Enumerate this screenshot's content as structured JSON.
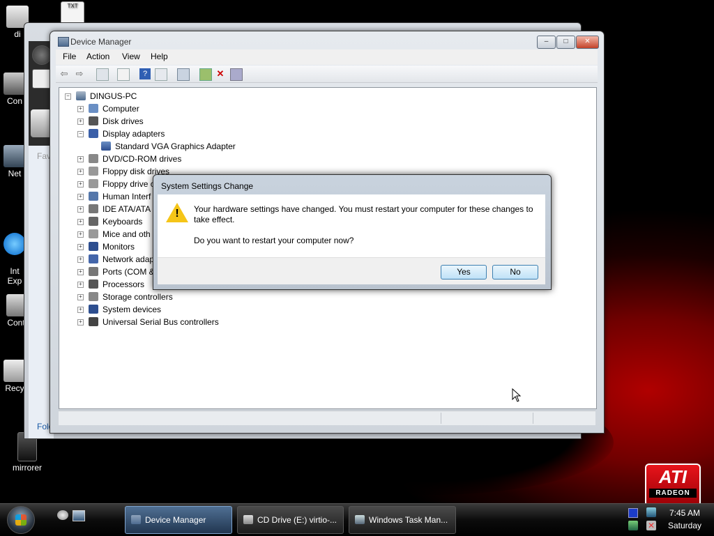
{
  "desktop": {
    "icons": [
      {
        "label": "di",
        "icon": "folder-icon"
      },
      {
        "label": "Con",
        "icon": "computer-icon"
      },
      {
        "label": "Net",
        "icon": "network-icon"
      },
      {
        "label": "Int\nExp",
        "icon": "ie-icon"
      },
      {
        "label": "Contr",
        "icon": "control-panel-icon"
      },
      {
        "label": "Recy",
        "icon": "recycle-bin-icon"
      },
      {
        "label": "mirrorer",
        "icon": "mirrorer-icon"
      }
    ],
    "txt_icon_label": "TXT"
  },
  "background_window": {
    "sidebar_labels": {
      "favorites": "Fav",
      "folders": "Folo"
    }
  },
  "device_manager": {
    "title": "Device Manager",
    "caption_buttons": {
      "minimize": "–",
      "maximize": "□",
      "close": "✕"
    },
    "menu": [
      "File",
      "Action",
      "View",
      "Help"
    ],
    "tree": {
      "root": "DINGUS-PC",
      "nodes": [
        {
          "label": "Computer",
          "expanded": false
        },
        {
          "label": "Disk drives",
          "expanded": false
        },
        {
          "label": "Display adapters",
          "expanded": true
        },
        {
          "label": "Standard VGA Graphics Adapter",
          "child": true
        },
        {
          "label": "DVD/CD-ROM drives",
          "expanded": false
        },
        {
          "label": "Floppy disk drives",
          "expanded": false
        },
        {
          "label": "Floppy drive c",
          "expanded": false
        },
        {
          "label": "Human Interf",
          "expanded": false
        },
        {
          "label": "IDE ATA/ATA",
          "expanded": false
        },
        {
          "label": "Keyboards",
          "expanded": false
        },
        {
          "label": "Mice and oth",
          "expanded": false
        },
        {
          "label": "Monitors",
          "expanded": false
        },
        {
          "label": "Network adap",
          "expanded": false
        },
        {
          "label": "Ports (COM &",
          "expanded": false
        },
        {
          "label": "Processors",
          "expanded": false
        },
        {
          "label": "Storage controllers",
          "expanded": false
        },
        {
          "label": "System devices",
          "expanded": false
        },
        {
          "label": "Universal Serial Bus controllers",
          "expanded": false
        }
      ]
    }
  },
  "dialog": {
    "title": "System Settings Change",
    "message_line1": "Your hardware settings have changed. You must restart your computer for these changes to",
    "message_line2": "take effect.",
    "question": "Do you want to restart your computer now?",
    "yes_label": "Yes",
    "no_label": "No"
  },
  "taskbar": {
    "tasks": [
      {
        "label": "Device Manager",
        "active": true
      },
      {
        "label": "CD Drive (E:) virtio-...",
        "active": false
      },
      {
        "label": "Windows Task Man...",
        "active": false
      }
    ],
    "clock_time": "7:45 AM",
    "clock_day": "Saturday"
  },
  "branding": {
    "ati_logo": "ATI",
    "radeon_label": "RADEON"
  },
  "colors": {
    "accent": "#4f6f93",
    "warning": "#f5c518",
    "ati_red": "#e8141b"
  }
}
